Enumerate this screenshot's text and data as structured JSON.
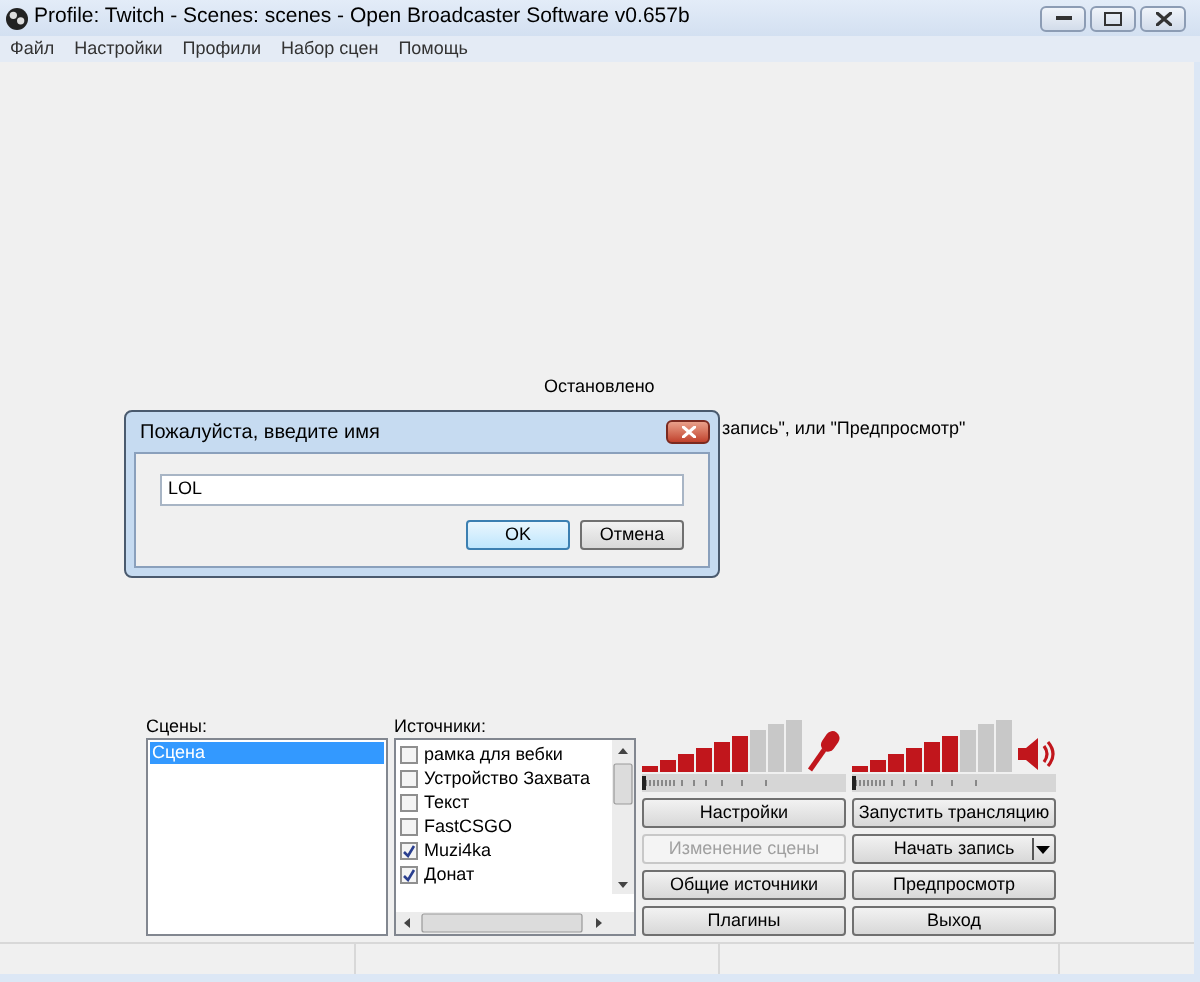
{
  "window": {
    "title": "Profile: Twitch - Scenes: scenes - Open Broadcaster Software v0.657b"
  },
  "menu": [
    "Файл",
    "Настройки",
    "Профили",
    "Набор сцен",
    "Помощь"
  ],
  "preview": {
    "status": "Остановлено",
    "hint": "запись\", или \"Предпросмотр\""
  },
  "dialog": {
    "title": "Пожалуйста, введите имя",
    "value": "LOL",
    "buttons": [
      {
        "label": "OK",
        "default": true
      },
      {
        "label": "Отмена",
        "default": false
      }
    ]
  },
  "scenes": {
    "label": "Сцены:",
    "items": [
      {
        "label": "Сцена",
        "selected": true
      }
    ]
  },
  "sources": {
    "label": "Источники:",
    "items": [
      {
        "label": "рамка для вебки",
        "checked": false
      },
      {
        "label": "Устройство Захвата",
        "checked": false
      },
      {
        "label": "Текст",
        "checked": false
      },
      {
        "label": "FastCSGO",
        "checked": false
      },
      {
        "label": "Muzi4ka",
        "checked": true
      },
      {
        "label": "Донат",
        "checked": true
      }
    ]
  },
  "meters": [
    {
      "kind": "mic",
      "level": 0.67,
      "slider": {
        "level": 0
      }
    },
    {
      "kind": "speaker",
      "level": 0.67,
      "slider": {
        "level": 0
      }
    }
  ],
  "buttons": [
    {
      "label": "Настройки",
      "disabled": false,
      "kind": "plain"
    },
    {
      "label": "Запустить трансляцию",
      "disabled": false,
      "kind": "plain"
    },
    {
      "label": "Изменение сцены",
      "disabled": true,
      "kind": "plain"
    },
    {
      "label": "Начать запись",
      "disabled": false,
      "kind": "split"
    },
    {
      "label": "Общие источники",
      "disabled": false,
      "kind": "plain"
    },
    {
      "label": "Предпросмотр",
      "disabled": false,
      "kind": "plain"
    },
    {
      "label": "Плагины",
      "disabled": false,
      "kind": "plain"
    },
    {
      "label": "Выход",
      "disabled": false,
      "kind": "plain"
    }
  ]
}
